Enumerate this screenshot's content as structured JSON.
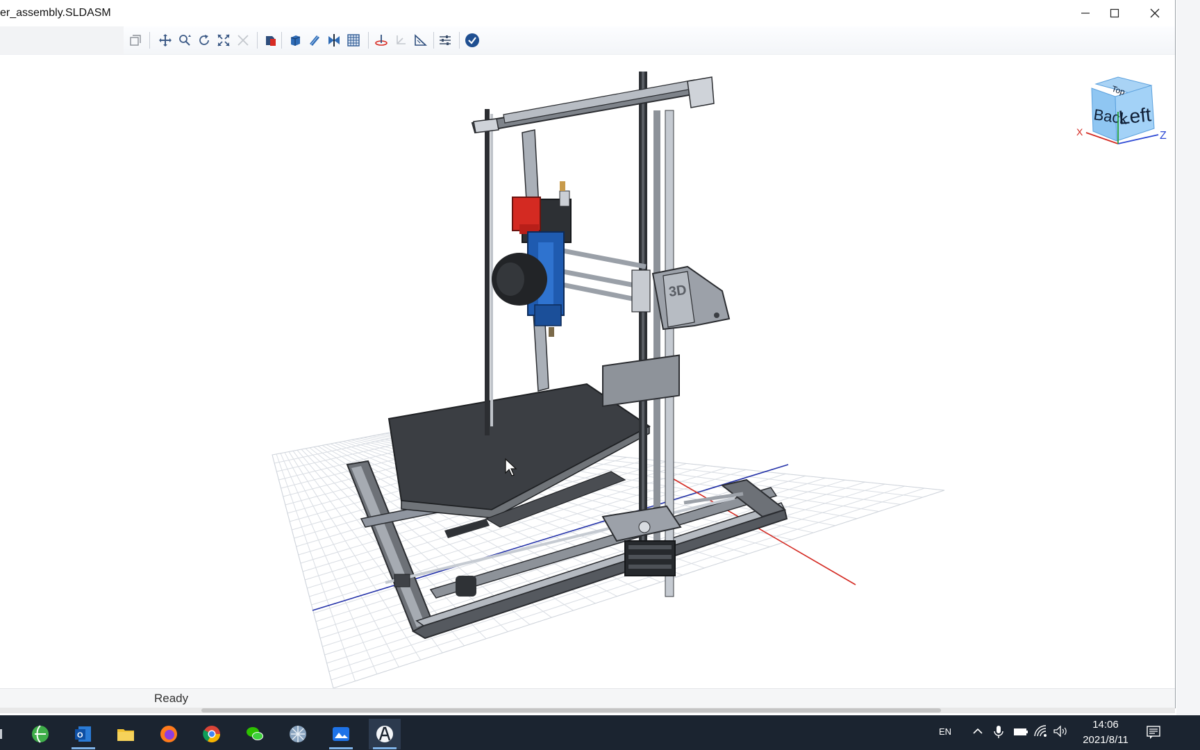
{
  "window": {
    "title": "er_assembly.SLDASM",
    "minimize_label": "Minimize",
    "maximize_label": "Maximize",
    "close_label": "Close"
  },
  "toolbar": {
    "items": [
      "copy",
      "pan",
      "zoom",
      "rotate",
      "fit-all",
      "explode",
      "appearance",
      "shaded",
      "section",
      "measure",
      "grid",
      "orientation-plane",
      "triad",
      "dimension",
      "settings",
      "confirm"
    ]
  },
  "viewcube": {
    "faces": [
      "Back",
      "Left",
      "Top"
    ],
    "axes": [
      "X",
      "Z"
    ]
  },
  "status": {
    "text": "Ready"
  },
  "taskbar": {
    "apps": [
      "ie-browser",
      "outlook",
      "file-explorer",
      "firefox",
      "chrome",
      "wechat",
      "network-app",
      "photos",
      "cad-viewer"
    ],
    "lang": "EN",
    "time": "14:06",
    "date": "2021/8/11"
  },
  "colors": {
    "accent_blue": "#1a5fb4",
    "frame_gray": "#8c9096",
    "bed_dark": "#3a3d42",
    "red_part": "#d42a22",
    "taskbar_bg": "#1b2430"
  }
}
